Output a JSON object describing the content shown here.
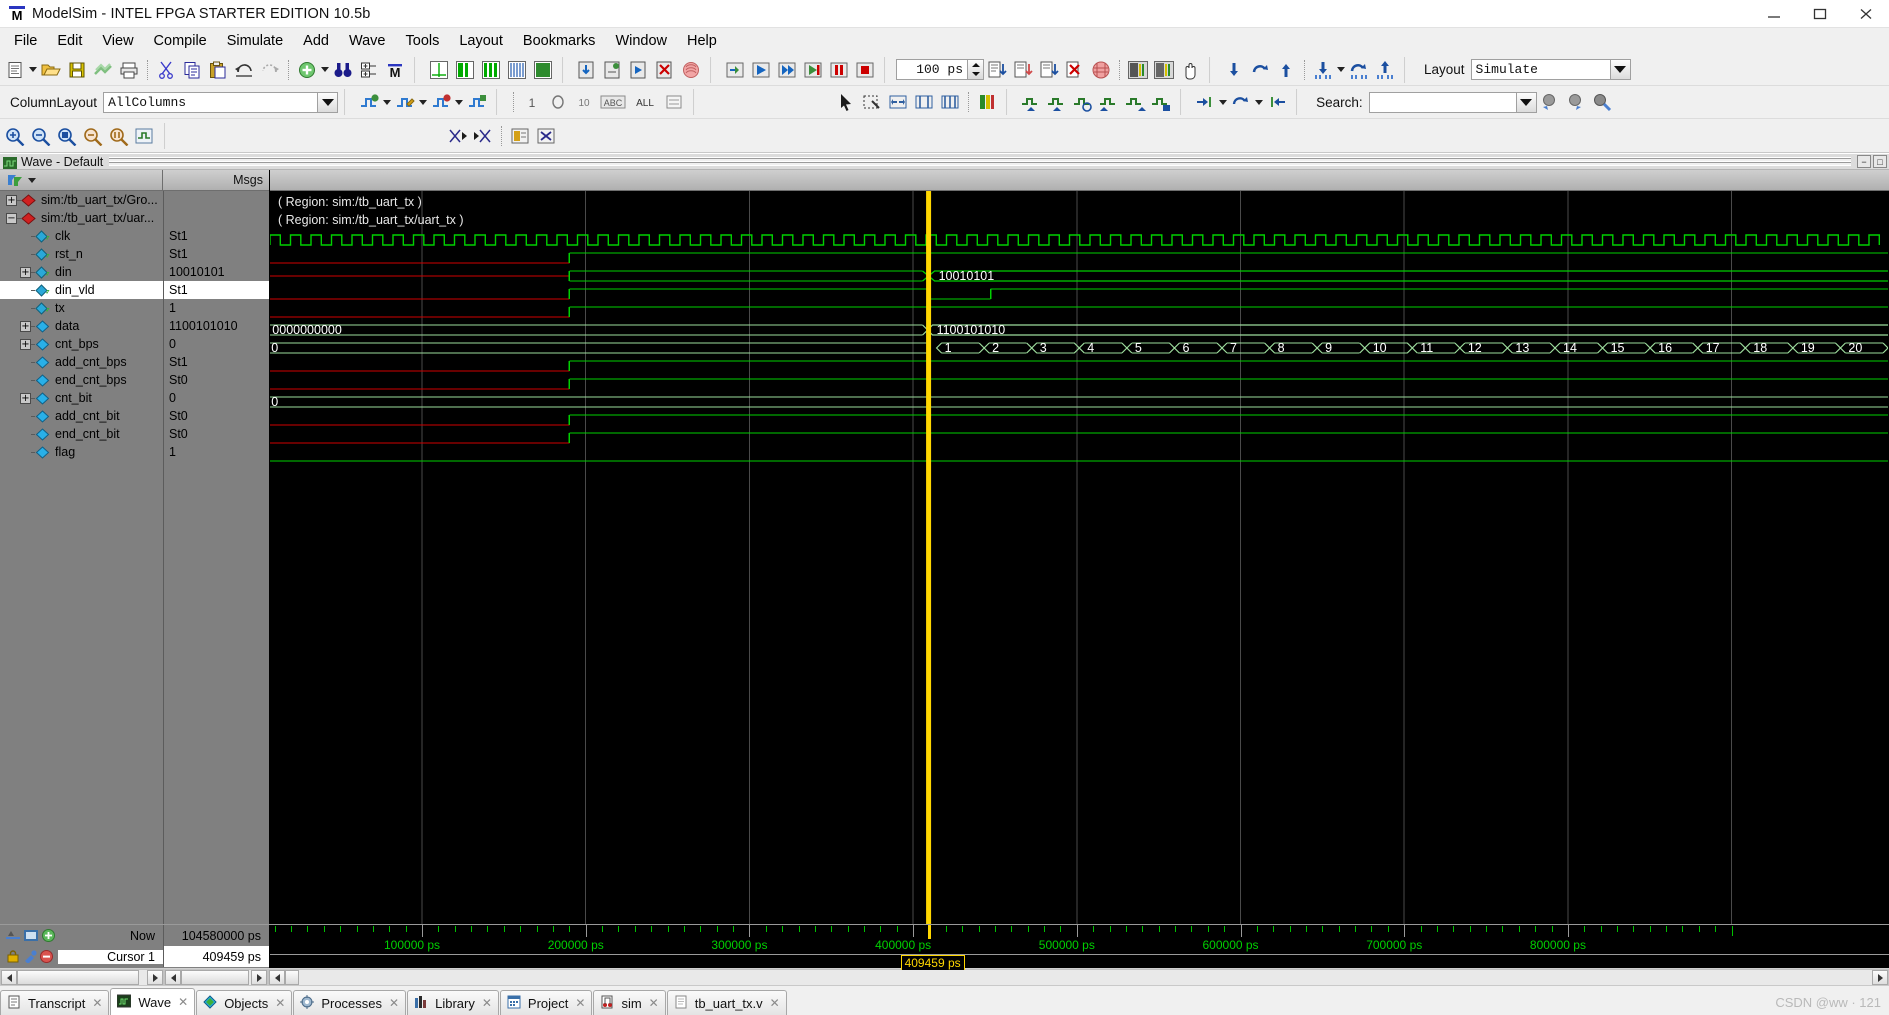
{
  "window": {
    "title": "ModelSim - INTEL FPGA STARTER EDITION 10.5b",
    "app_icon": "modelsim-m-icon",
    "minimize": "minimize-icon",
    "maximize": "maximize-icon",
    "close": "close-icon"
  },
  "menu": {
    "items": [
      "File",
      "Edit",
      "View",
      "Compile",
      "Simulate",
      "Add",
      "Wave",
      "Tools",
      "Layout",
      "Bookmarks",
      "Window",
      "Help"
    ]
  },
  "toolbar": {
    "sim_time_value": "100 ps",
    "layout_label": "Layout",
    "layout_value": "Simulate",
    "columnlayout_label": "ColumnLayout",
    "columnlayout_value": "AllColumns",
    "search_label": "Search:",
    "search_value": "",
    "search_placeholder": ""
  },
  "wave_window": {
    "title": "Wave - Default",
    "msgs_header": "Msgs",
    "region_labels": [
      "( Region: sim:/tb_uart_tx )",
      "( Region: sim:/tb_uart_tx/uart_tx )"
    ],
    "signals": [
      {
        "name": "sim:/tb_uart_tx/Gro...",
        "value": "",
        "indent": 0,
        "expander": "+",
        "icon": "red-diamond-icon",
        "selected": false,
        "type": "group"
      },
      {
        "name": "sim:/tb_uart_tx/uar...",
        "value": "",
        "indent": 0,
        "expander": "-",
        "icon": "red-diamond-icon",
        "selected": false,
        "type": "group"
      },
      {
        "name": "clk",
        "value": "St1",
        "indent": 1,
        "expander": "",
        "icon": "input-signal-icon",
        "selected": false,
        "type": "signal"
      },
      {
        "name": "rst_n",
        "value": "St1",
        "indent": 1,
        "expander": "",
        "icon": "input-signal-icon",
        "selected": false,
        "type": "signal"
      },
      {
        "name": "din",
        "value": "10010101",
        "indent": 1,
        "expander": "+",
        "icon": "input-signal-icon",
        "selected": false,
        "type": "bus"
      },
      {
        "name": "din_vld",
        "value": "St1",
        "indent": 1,
        "expander": "",
        "icon": "input-signal-icon",
        "selected": true,
        "type": "signal"
      },
      {
        "name": "tx",
        "value": "1",
        "indent": 1,
        "expander": "",
        "icon": "output-signal-icon",
        "selected": false,
        "type": "signal"
      },
      {
        "name": "data",
        "value": "1100101010",
        "indent": 1,
        "expander": "+",
        "icon": "internal-signal-icon",
        "selected": false,
        "type": "bus"
      },
      {
        "name": "cnt_bps",
        "value": "0",
        "indent": 1,
        "expander": "+",
        "icon": "internal-signal-icon",
        "selected": false,
        "type": "bus"
      },
      {
        "name": "add_cnt_bps",
        "value": "St1",
        "indent": 1,
        "expander": "",
        "icon": "internal-signal-icon",
        "selected": false,
        "type": "signal"
      },
      {
        "name": "end_cnt_bps",
        "value": "St0",
        "indent": 1,
        "expander": "",
        "icon": "internal-signal-icon",
        "selected": false,
        "type": "signal"
      },
      {
        "name": "cnt_bit",
        "value": "0",
        "indent": 1,
        "expander": "+",
        "icon": "internal-signal-icon",
        "selected": false,
        "type": "bus"
      },
      {
        "name": "add_cnt_bit",
        "value": "St0",
        "indent": 1,
        "expander": "",
        "icon": "internal-signal-icon",
        "selected": false,
        "type": "signal"
      },
      {
        "name": "end_cnt_bit",
        "value": "St0",
        "indent": 1,
        "expander": "",
        "icon": "internal-signal-icon",
        "selected": false,
        "type": "signal"
      },
      {
        "name": "flag",
        "value": "1",
        "indent": 1,
        "expander": "",
        "icon": "internal-signal-icon",
        "selected": false,
        "type": "signal"
      }
    ],
    "bus_labels": {
      "din": "10010101",
      "data_before": "0000000000",
      "data_after": "1100101010",
      "cnt_bps_initial": "0",
      "cnt_bit_initial": "0",
      "cnt_bps_sequence": [
        "1",
        "2",
        "3",
        "4",
        "5",
        "6",
        "7",
        "8",
        "9",
        "10",
        "11",
        "12",
        "13",
        "14",
        "15",
        "16",
        "17",
        "18",
        "19",
        "20"
      ]
    },
    "status": {
      "now_label": "Now",
      "now_value": "104580000 ps",
      "cursor_label": "Cursor 1",
      "cursor_value": "409459 ps",
      "cursor_flag": "409459 ps"
    },
    "timeline": {
      "labels": [
        "100000 ps",
        "200000 ps",
        "300000 ps",
        "400000 ps",
        "500000 ps",
        "600000 ps",
        "700000 ps",
        "800000 ps"
      ]
    }
  },
  "tabs": [
    {
      "label": "Transcript",
      "icon": "transcript-icon",
      "active": false
    },
    {
      "label": "Wave",
      "icon": "wave-icon",
      "active": true
    },
    {
      "label": "Objects",
      "icon": "objects-icon",
      "active": false
    },
    {
      "label": "Processes",
      "icon": "processes-icon",
      "active": false
    },
    {
      "label": "Library",
      "icon": "library-icon",
      "active": false
    },
    {
      "label": "Project",
      "icon": "project-icon",
      "active": false
    },
    {
      "label": "sim",
      "icon": "sim-icon",
      "active": false
    },
    {
      "label": "tb_uart_tx.v",
      "icon": "file-icon",
      "active": false
    }
  ],
  "watermark": "CSDN @ww · 121",
  "colors": {
    "wave_green": "#00d000",
    "wave_red": "#d00000",
    "cursor_yellow": "#ffd700",
    "bus_text": "#ffffff",
    "panel_gray": "#808080",
    "canvas_black": "#000000"
  }
}
